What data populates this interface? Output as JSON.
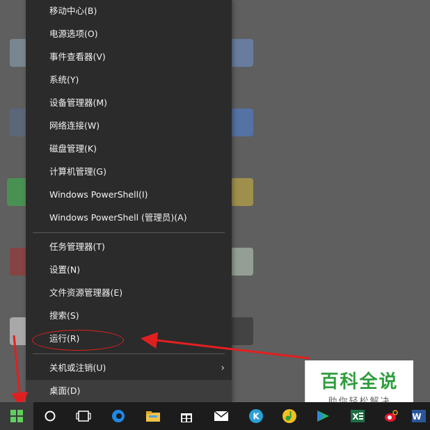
{
  "menu": {
    "items": [
      {
        "label": "移动中心(B)"
      },
      {
        "label": "电源选项(O)"
      },
      {
        "label": "事件查看器(V)"
      },
      {
        "label": "系统(Y)"
      },
      {
        "label": "设备管理器(M)"
      },
      {
        "label": "网络连接(W)"
      },
      {
        "label": "磁盘管理(K)"
      },
      {
        "label": "计算机管理(G)"
      },
      {
        "label": "Windows PowerShell(I)"
      },
      {
        "label": "Windows PowerShell (管理员)(A)"
      },
      {
        "label": "任务管理器(T)"
      },
      {
        "label": "设置(N)"
      },
      {
        "label": "文件资源管理器(E)"
      },
      {
        "label": "搜索(S)"
      },
      {
        "label": "运行(R)"
      },
      {
        "label": "关机或注销(U)"
      },
      {
        "label": "桌面(D)"
      }
    ]
  },
  "taskbar": {
    "icons": [
      "windows-start-icon",
      "cortana-icon",
      "task-view-icon",
      "edge-icon",
      "file-explorer-icon",
      "store-icon",
      "mail-icon",
      "k-app-icon",
      "music-app-icon",
      "video-app-icon",
      "excel-icon",
      "weibo-icon",
      "word-icon"
    ]
  },
  "watermark": {
    "title": "百科全说",
    "subtitle": "助你轻松解决"
  },
  "colors": {
    "menu_bg": "#2b2b2b",
    "taskbar_bg": "#1c1c1c",
    "annotation_red": "#e02020",
    "watermark_green": "#2e9e3e"
  }
}
